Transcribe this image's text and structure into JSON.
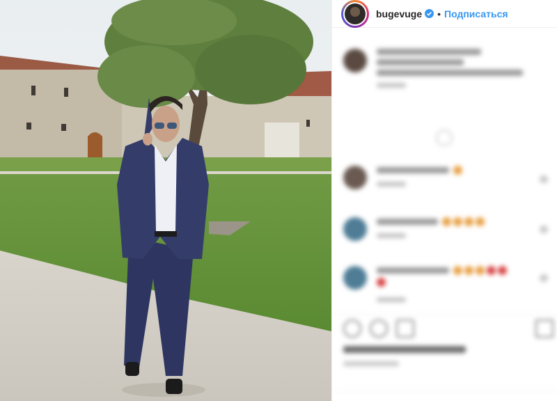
{
  "header": {
    "username": "bugevuge",
    "separator": "•",
    "follow_label": "Подписаться"
  },
  "icons": {
    "verified": "verified-badge-icon",
    "more": "more-comments-icon",
    "like": "heart-icon",
    "comment": "comment-icon",
    "share": "share-icon",
    "save": "bookmark-icon"
  },
  "colors": {
    "accent": "#3897f0",
    "text": "#262626",
    "border": "#efefef"
  }
}
